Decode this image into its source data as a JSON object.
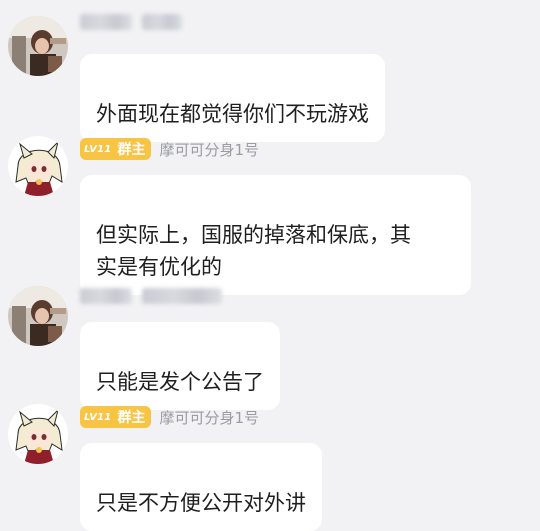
{
  "messages": [
    {
      "sender_type": "member",
      "avatar_icon": "user-avatar-photo-icon",
      "text": "外面现在都觉得你们不玩游戏"
    },
    {
      "sender_type": "owner",
      "avatar_icon": "anime-avatar-icon",
      "level_badge": "LV11",
      "role_badge": "群主",
      "nickname": "摩可可分身1号",
      "text": "但实际上，国服的掉落和保底，其\n实是有优化的"
    },
    {
      "sender_type": "member",
      "avatar_icon": "user-avatar-photo-icon",
      "text": "只能是发个公告了"
    },
    {
      "sender_type": "owner",
      "avatar_icon": "anime-avatar-icon",
      "level_badge": "LV11",
      "role_badge": "群主",
      "nickname": "摩可可分身1号",
      "text": "只是不方便公开对外讲"
    }
  ],
  "colors": {
    "background": "#f2f2f4",
    "bubble": "#ffffff",
    "badge": "#f7c443",
    "nickname": "#9b9ca3",
    "text": "#1f1f1f"
  }
}
